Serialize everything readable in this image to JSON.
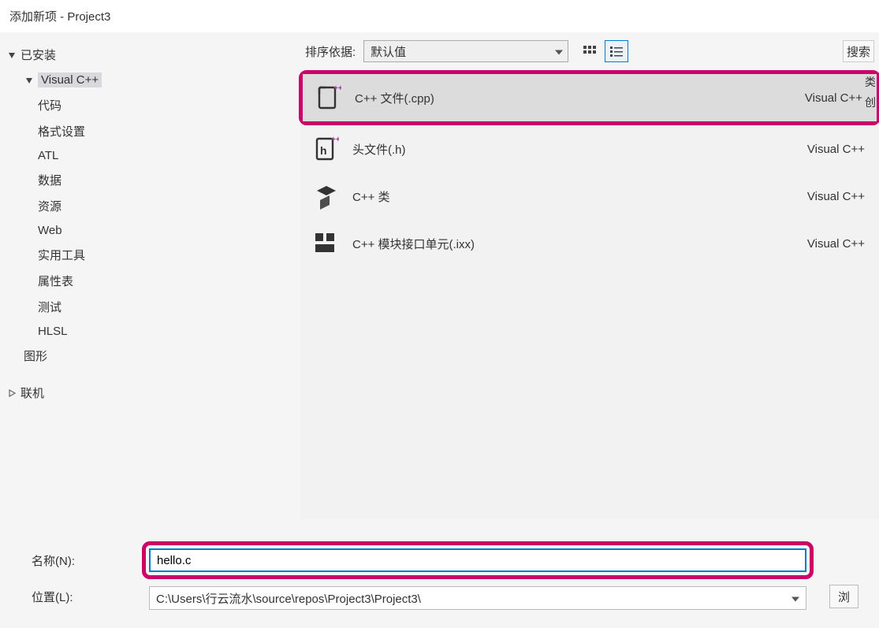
{
  "dialog": {
    "title": "添加新项 - Project3"
  },
  "tree": {
    "installed": {
      "label": "已安装"
    },
    "visual_cpp": {
      "label": "Visual C++"
    },
    "children": [
      {
        "label": "代码"
      },
      {
        "label": "格式设置"
      },
      {
        "label": "ATL"
      },
      {
        "label": "数据"
      },
      {
        "label": "资源"
      },
      {
        "label": "Web"
      },
      {
        "label": "实用工具"
      },
      {
        "label": "属性表"
      },
      {
        "label": "测试"
      },
      {
        "label": "HLSL"
      }
    ],
    "graphics": {
      "label": "图形"
    },
    "online": {
      "label": "联机"
    }
  },
  "toolbar": {
    "sort_label": "排序依据:",
    "sort_value": "默认值",
    "search_text": "搜索"
  },
  "templates": [
    {
      "name": "C++ 文件(.cpp)",
      "lang": "Visual C++",
      "icon": "cpp-file",
      "selected": true
    },
    {
      "name": "头文件(.h)",
      "lang": "Visual C++",
      "icon": "header-file",
      "selected": false
    },
    {
      "name": "C++ 类",
      "lang": "Visual C++",
      "icon": "class",
      "selected": false
    },
    {
      "name": "C++ 模块接口单元(.ixx)",
      "lang": "Visual C++",
      "icon": "module",
      "selected": false
    }
  ],
  "right_strip": {
    "a": "类",
    "b": "创"
  },
  "form": {
    "name_label": "名称(N):",
    "name_value": "hello.c",
    "location_label": "位置(L):",
    "location_value": "C:\\Users\\行云流水\\source\\repos\\Project3\\Project3\\",
    "browse_label": "浏"
  }
}
